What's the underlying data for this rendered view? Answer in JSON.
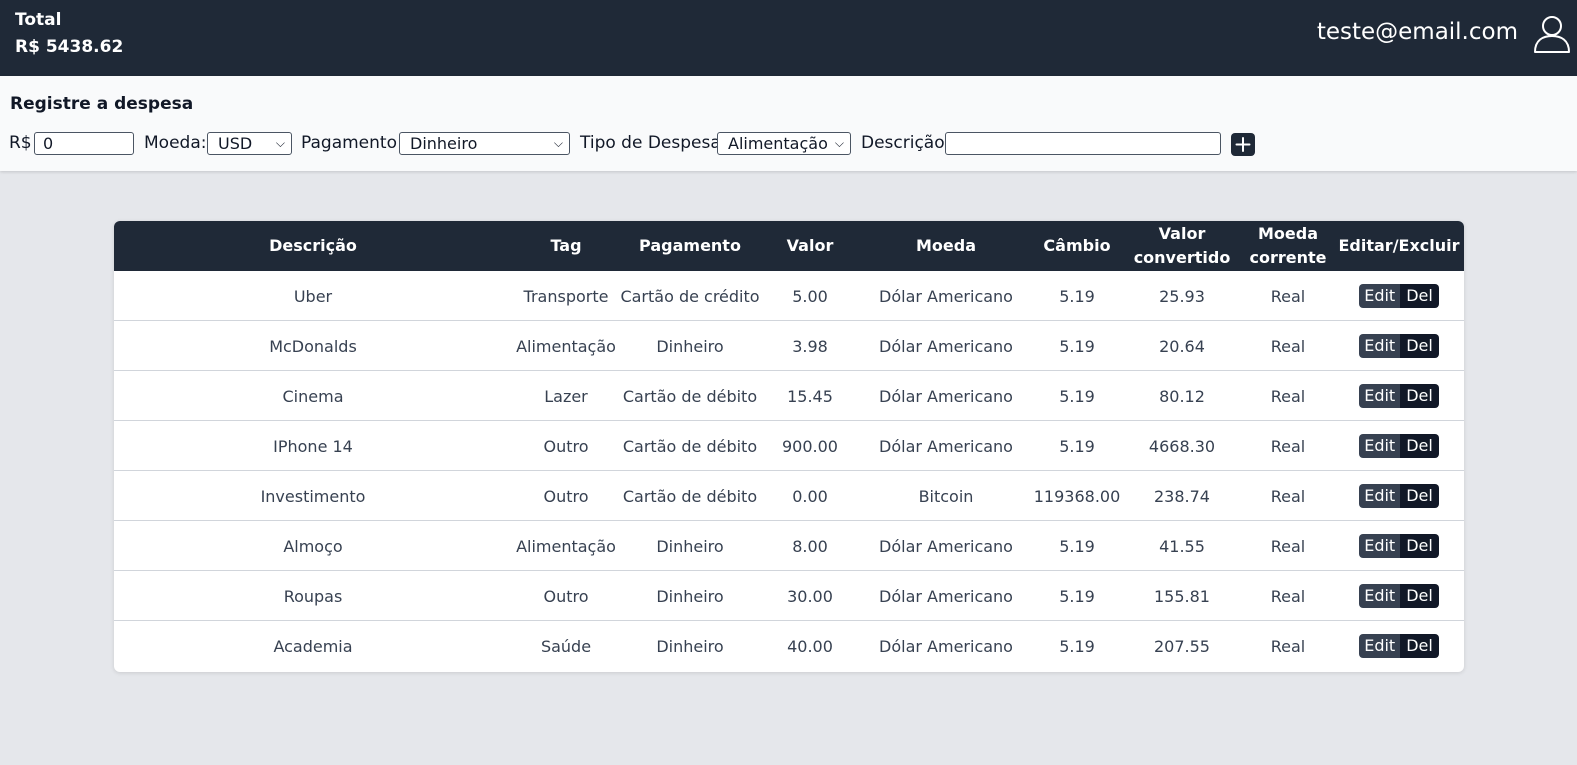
{
  "header": {
    "total_label": "Total",
    "total_value": "R$ 5438.62",
    "email": "teste@email.com",
    "user_icon": "user-icon"
  },
  "form": {
    "title": "Registre a despesa",
    "value_label": "R$",
    "value_input": "0",
    "currency_label": "Moeda:",
    "currency_selected": "USD",
    "payment_label": "Pagamento:",
    "payment_selected": "Dinheiro",
    "type_label": "Tipo de Despesa:",
    "type_selected": "Alimentação",
    "description_label": "Descrição:",
    "description_input": "",
    "add_icon": "plus-icon"
  },
  "table": {
    "headers": {
      "descricao": "Descrição",
      "tag": "Tag",
      "pagamento": "Pagamento",
      "valor": "Valor",
      "moeda": "Moeda",
      "cambio": "Câmbio",
      "valor_convertido": "Valor convertido",
      "moeda_corrente": "Moeda corrente",
      "editar_excluir": "Editar/Excluir"
    },
    "edit_label": "Edit",
    "delete_label": "Del",
    "rows": [
      {
        "descricao": "Uber",
        "tag": "Transporte",
        "pagamento": "Cartão de crédito",
        "valor": "5.00",
        "moeda": "Dólar Americano",
        "cambio": "5.19",
        "convertido": "25.93",
        "corrente": "Real"
      },
      {
        "descricao": "McDonalds",
        "tag": "Alimentação",
        "pagamento": "Dinheiro",
        "valor": "3.98",
        "moeda": "Dólar Americano",
        "cambio": "5.19",
        "convertido": "20.64",
        "corrente": "Real"
      },
      {
        "descricao": "Cinema",
        "tag": "Lazer",
        "pagamento": "Cartão de débito",
        "valor": "15.45",
        "moeda": "Dólar Americano",
        "cambio": "5.19",
        "convertido": "80.12",
        "corrente": "Real"
      },
      {
        "descricao": "IPhone 14",
        "tag": "Outro",
        "pagamento": "Cartão de débito",
        "valor": "900.00",
        "moeda": "Dólar Americano",
        "cambio": "5.19",
        "convertido": "4668.30",
        "corrente": "Real"
      },
      {
        "descricao": "Investimento",
        "tag": "Outro",
        "pagamento": "Cartão de débito",
        "valor": "0.00",
        "moeda": "Bitcoin",
        "cambio": "119368.00",
        "convertido": "238.74",
        "corrente": "Real"
      },
      {
        "descricao": "Almoço",
        "tag": "Alimentação",
        "pagamento": "Dinheiro",
        "valor": "8.00",
        "moeda": "Dólar Americano",
        "cambio": "5.19",
        "convertido": "41.55",
        "corrente": "Real"
      },
      {
        "descricao": "Roupas",
        "tag": "Outro",
        "pagamento": "Dinheiro",
        "valor": "30.00",
        "moeda": "Dólar Americano",
        "cambio": "5.19",
        "convertido": "155.81",
        "corrente": "Real"
      },
      {
        "descricao": "Academia",
        "tag": "Saúde",
        "pagamento": "Dinheiro",
        "valor": "40.00",
        "moeda": "Dólar Americano",
        "cambio": "5.19",
        "convertido": "207.55",
        "corrente": "Real"
      }
    ]
  }
}
